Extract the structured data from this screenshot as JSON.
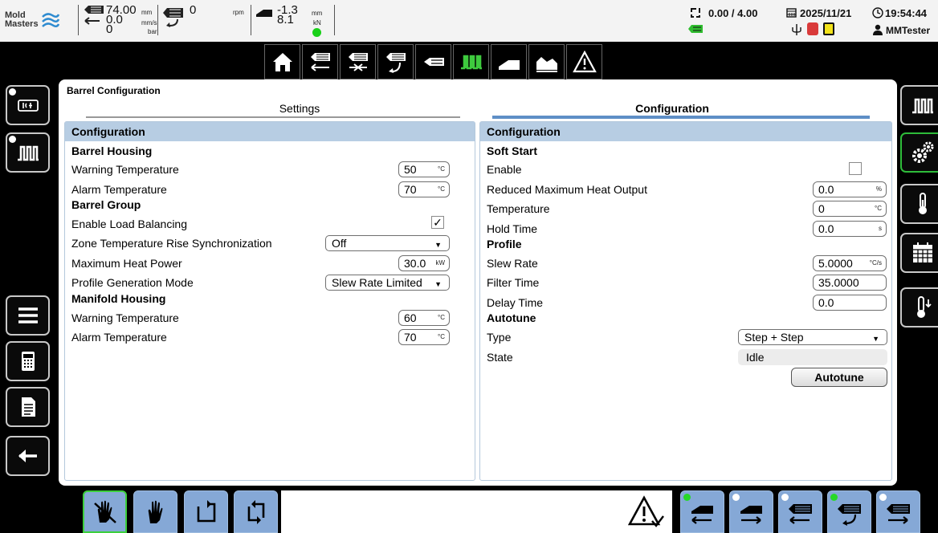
{
  "header": {
    "logo_text_1": "Mold",
    "logo_text_2": "Masters",
    "position_value": "74.00",
    "position_unit": "mm",
    "speed_value": "0.0",
    "speed_unit": "mm/s",
    "pressure_value": "0",
    "pressure_unit": "bar",
    "rpm_value": "0",
    "rpm_unit": "rpm",
    "carriage_value_top": "-1.3",
    "carriage_value_bottom": "8.1",
    "carriage_unit_top": "mm",
    "carriage_unit_bottom": "kN",
    "cycle_text": "0.00 / 4.00",
    "date": "2025/11/21",
    "time": "19:54:44",
    "user": "MMTester",
    "status_color": "#19d019"
  },
  "topnav": {
    "items": [
      "home-icon",
      "injection-icon",
      "hold-icon",
      "screw-recovery-icon",
      "decompress-icon",
      "barrel-heat-icon",
      "carriage-icon",
      "profile-chart-icon",
      "warning-icon"
    ],
    "active_color": "#3ecb3e"
  },
  "main": {
    "breadcrumb": "Barrel Configuration",
    "tabs": [
      {
        "label": "Settings",
        "active": false
      },
      {
        "label": "Configuration",
        "active": true
      }
    ],
    "left": {
      "header": "Configuration",
      "barrel_housing": {
        "title": "Barrel Housing",
        "warning_label": "Warning Temperature",
        "warning_value": "50",
        "warning_unit": "°C",
        "alarm_label": "Alarm Temperature",
        "alarm_value": "70",
        "alarm_unit": "°C"
      },
      "barrel_group": {
        "title": "Barrel Group",
        "load_balancing_label": "Enable Load Balancing",
        "load_balancing_checked": true,
        "load_balancing_mark": "✓",
        "sync_label": "Zone Temperature Rise Synchronization",
        "sync_value": "Off",
        "max_heat_label": "Maximum Heat Power",
        "max_heat_value": "30.0",
        "max_heat_unit": "kW",
        "profile_mode_label": "Profile Generation Mode",
        "profile_mode_value": "Slew Rate Limited"
      },
      "manifold_housing": {
        "title": "Manifold Housing",
        "warning_label": "Warning Temperature",
        "warning_value": "60",
        "warning_unit": "°C",
        "alarm_label": "Alarm Temperature",
        "alarm_value": "70",
        "alarm_unit": "°C"
      }
    },
    "right": {
      "header": "Configuration",
      "soft_start": {
        "title": "Soft Start",
        "enable_label": "Enable",
        "enable_checked": false,
        "reduced_label": "Reduced Maximum Heat Output",
        "reduced_value": "0.0",
        "reduced_unit": "%",
        "temperature_label": "Temperature",
        "temperature_value": "0",
        "temperature_unit": "°C",
        "hold_label": "Hold Time",
        "hold_value": "0.0",
        "hold_unit": "s"
      },
      "profile": {
        "title": "Profile",
        "slew_label": "Slew Rate",
        "slew_value": "5.0000",
        "slew_unit": "°C/s",
        "filter_label": "Filter Time",
        "filter_value": "35.0000",
        "delay_label": "Delay Time",
        "delay_value": "0.0"
      },
      "autotune": {
        "title": "Autotune",
        "type_label": "Type",
        "type_value": "Step + Step",
        "state_label": "State",
        "state_value": "Idle",
        "button_label": "Autotune"
      }
    }
  },
  "left_sidebar": [
    "machine-power-icon",
    "barrel-heat-icon",
    "menu-icon",
    "calculator-icon",
    "document-icon",
    "back-arrow-icon"
  ],
  "right_sidebar": [
    "barrel-heat-icon",
    "configuration-gears-icon",
    "thermometer-icon",
    "calendar-icon",
    "temperature-down-icon"
  ],
  "bottom_bar": {
    "mode_buttons": [
      "setup-hand-icon",
      "manual-hand-icon",
      "semi-auto-icon",
      "auto-cycle-icon"
    ],
    "alarm_icon": "alarm-acknowledge-icon",
    "function_buttons": [
      "carriage-back-icon",
      "carriage-forward-icon",
      "injection-back-icon",
      "screw-recovery-icon",
      "injection-forward-icon"
    ]
  }
}
